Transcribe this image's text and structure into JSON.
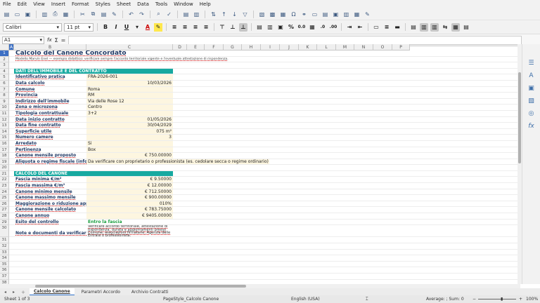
{
  "menu": [
    "File",
    "Edit",
    "View",
    "Insert",
    "Format",
    "Styles",
    "Sheet",
    "Data",
    "Tools",
    "Window",
    "Help"
  ],
  "format_bar": {
    "font": "Calibri",
    "size": "11 pt"
  },
  "name_box": "A1",
  "formula_symbols": {
    "fx": "fx",
    "sum": "Σ",
    "eq": "="
  },
  "columns": [
    "A",
    "B",
    "C",
    "D",
    "E",
    "F",
    "G",
    "H",
    "I",
    "J",
    "K",
    "L",
    "M",
    "N",
    "O",
    "P"
  ],
  "rows": [
    "1",
    "2",
    "3",
    "4",
    "5",
    "6",
    "7",
    "8",
    "9",
    "10",
    "11",
    "12",
    "13",
    "14",
    "15",
    "16",
    "17",
    "18",
    "19",
    "20",
    "21",
    "22",
    "23",
    "24",
    "25",
    "26",
    "27",
    "28",
    "29",
    "30",
    "31",
    "32",
    "33",
    "34",
    "35",
    "36",
    "37",
    "38"
  ],
  "sheet": {
    "title": "Calcolo del Canone Concordato",
    "subtitle": "Modello Marvin Enel — esempio didattico: verificare sempre l'accordo territoriale vigente e l'eventuale attestazione di rispondenza.",
    "section1": "DATI DELL'IMMOBILE E DEL CONTRATTO",
    "rows1": [
      {
        "label": "Identificativo pratica",
        "value": "FRA-2026-001",
        "align": "left"
      },
      {
        "label": "Data calcolo",
        "value": "10/03/2026",
        "align": "right"
      },
      {
        "label": "Comune",
        "value": "Roma",
        "align": "left"
      },
      {
        "label": "Provincia",
        "value": "RM",
        "align": "left"
      },
      {
        "label": "Indirizzo dell'immobile",
        "value": "Via delle Rose 12",
        "align": "left"
      },
      {
        "label": "Zona o microzona",
        "value": "Centro",
        "align": "left"
      },
      {
        "label": "Tipologia contrattuale",
        "value": "3+2",
        "align": "left"
      },
      {
        "label": "Data inizio contratto",
        "value": "01/05/2026",
        "align": "right"
      },
      {
        "label": "Data fine contratto",
        "value": "30/04/2029",
        "align": "right"
      },
      {
        "label": "Superficie utile",
        "value": "075 m²",
        "align": "right"
      },
      {
        "label": "Numero camere",
        "value": "3",
        "align": "right"
      },
      {
        "label": "Arredato",
        "value": "Si",
        "align": "left"
      },
      {
        "label": "Pertinenza",
        "value": "Box",
        "align": "left"
      },
      {
        "label": "Canone mensile proposto",
        "value": "€ 750.00000",
        "align": "right"
      }
    ],
    "row19": {
      "label": "Aliquota o regime fiscale (informa",
      "value": "Da verificare con proprietario o professionista (es. cedolare secca o regime ordinario)"
    },
    "section2": "CALCOLO DEL CANONE",
    "rows2": [
      {
        "label": "Fascia minima €/m²",
        "value": "€ 9.50000"
      },
      {
        "label": "Fascia massima €/m²",
        "value": "€ 12.00000"
      },
      {
        "label": "Canone minimo mensile",
        "value": "€ 712.50000"
      },
      {
        "label": "Canone massimo mensile",
        "value": "€ 900.00000"
      },
      {
        "label": "Maggiorazione o riduzione applica",
        "value": "010%"
      },
      {
        "label": "Canone mensile calcolato",
        "value": "€ 783.75000"
      },
      {
        "label": "Canone annuo",
        "value": "€ 9405.00000"
      }
    ],
    "esito": {
      "label": "Esito del controllo",
      "value": "Entro la fascia"
    },
    "note": {
      "label": "Note e documenti da verificare:",
      "value": "Verificare accordo territoriale, attestazione di rispondenza, durata e aggiornamenti presso Comune, associazioni firmatarie, Agenzia delle Entrate o professionista."
    }
  },
  "tabs": [
    "Calcolo Canone",
    "Parametri Accordo",
    "Archivio Contratti"
  ],
  "status": {
    "sheet": "Sheet 1 of 3",
    "style": "PageStyle_Calcolo Canone",
    "lang": "English (USA)",
    "sum": "Average: ; Sum: 0",
    "zoom": "100%"
  },
  "colors": {
    "section": "#17a9a0",
    "value_bg": "#fdf6e0",
    "label": "#1f3864"
  }
}
